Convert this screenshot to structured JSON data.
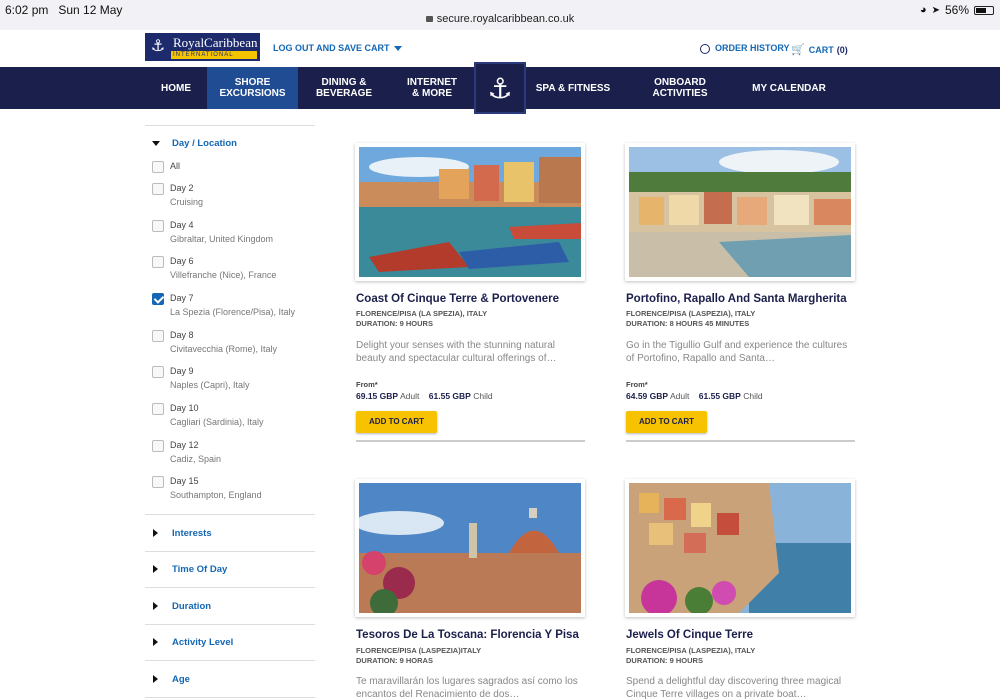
{
  "status_bar": {
    "time": "6:02 pm",
    "date": "Sun 12 May",
    "url": "secure.royalcaribbean.co.uk",
    "battery": "56%"
  },
  "header": {
    "brand": "RoyalCaribbean",
    "brand_sub": "INTERNATIONAL",
    "logout": "LOG OUT AND SAVE CART",
    "order_history": "ORDER HISTORY",
    "cart_label": "CART",
    "cart_count": "(0)"
  },
  "nav": {
    "items": [
      {
        "label": "HOME"
      },
      {
        "label": "SHORE EXCURSIONS"
      },
      {
        "label": "DINING & BEVERAGE"
      },
      {
        "label": "INTERNET & MORE"
      },
      {
        "label": "SPA & FITNESS"
      },
      {
        "label": "ONBOARD ACTIVITIES"
      },
      {
        "label": "MY CALENDAR"
      }
    ]
  },
  "sidebar": {
    "day_location_label": "Day / Location",
    "options": [
      {
        "day": "All",
        "location": ""
      },
      {
        "day": "Day 2",
        "location": "Cruising"
      },
      {
        "day": "Day 4",
        "location": "Gibraltar, United Kingdom"
      },
      {
        "day": "Day 6",
        "location": "Villefranche (Nice), France"
      },
      {
        "day": "Day 7",
        "location": "La Spezia (Florence/Pisa), Italy"
      },
      {
        "day": "Day 8",
        "location": "Civitavecchia (Rome), Italy"
      },
      {
        "day": "Day 9",
        "location": "Naples (Capri), Italy"
      },
      {
        "day": "Day 10",
        "location": "Cagliari (Sardinia), Italy"
      },
      {
        "day": "Day 12",
        "location": "Cadiz, Spain"
      },
      {
        "day": "Day 15",
        "location": "Southampton, England"
      }
    ],
    "filters": [
      {
        "label": "Interests"
      },
      {
        "label": "Time Of Day"
      },
      {
        "label": "Duration"
      },
      {
        "label": "Activity Level"
      },
      {
        "label": "Age"
      }
    ]
  },
  "cards": [
    {
      "title": "Coast Of Cinque Terre & Portovenere",
      "port": "FLORENCE/PISA (LA SPEZIA), ITALY",
      "duration": "DURATION: 9 HOURS",
      "desc": "Delight your senses with the stunning natural beauty and spectacular cultural offerings of…",
      "from": "From*",
      "adult_price": "69.15 GBP",
      "adult_label": "Adult",
      "child_price": "61.55 GBP",
      "child_label": "Child",
      "button": "ADD TO CART"
    },
    {
      "title": "Portofino, Rapallo And Santa Margherita",
      "port": "FLORENCE/PISA (LASPEZIA), ITALY",
      "duration": "DURATION: 8 HOURS 45 MINUTES",
      "desc": "Go in the Tigullio Gulf and experience the cultures of Portofino, Rapallo and Santa…",
      "from": "From*",
      "adult_price": "64.59 GBP",
      "adult_label": "Adult",
      "child_price": "61.55 GBP",
      "child_label": "Child",
      "button": "ADD TO CART"
    },
    {
      "title": "Tesoros De La Toscana: Florencia Y Pisa",
      "port": "FLORENCE/PISA (LASPEZIA)ITALY",
      "duration": "DURATION: 9 HORAS",
      "desc": "Te maravillarán los lugares sagrados así como los encantos del Renacimiento de dos…"
    },
    {
      "title": "Jewels Of Cinque Terre",
      "port": "FLORENCE/PISA (LASPEZIA), ITALY",
      "duration": "DURATION: 9 HOURS",
      "desc": "Spend a delightful day discovering three magical Cinque Terre villages on a private boat…"
    }
  ],
  "colors": {
    "nav_bg": "#1b1f4b",
    "nav_active": "#1f4c92",
    "link": "#1467b5",
    "button": "#f7c200"
  }
}
